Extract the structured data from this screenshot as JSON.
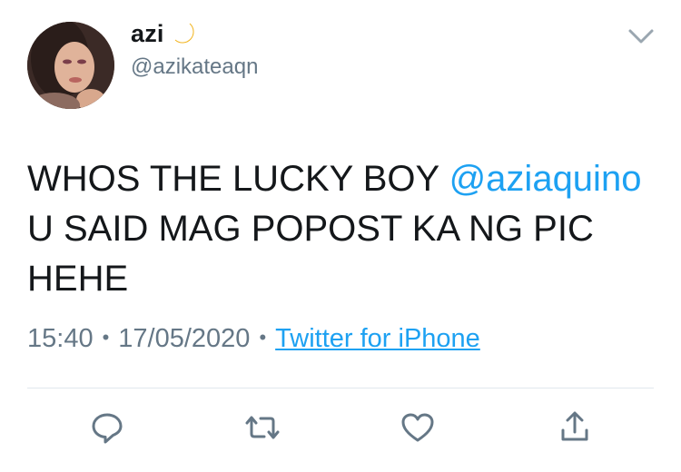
{
  "user": {
    "name": "azi",
    "name_emoji": "crescent-moon",
    "handle": "@azikateaqn"
  },
  "tweet": {
    "text_part1": "WHOS THE LUCKY BOY ",
    "mention": "@aziaquino",
    "text_part2": " U SAID MAG POPOST KA NG PIC HEHE"
  },
  "meta": {
    "time": "15:40",
    "separator": "•",
    "date": "17/05/2020",
    "source": "Twitter for iPhone"
  },
  "actions": {
    "reply_icon": "reply-icon",
    "retweet_icon": "retweet-icon",
    "like_icon": "heart-icon",
    "share_icon": "share-icon"
  },
  "colors": {
    "accent": "#1da1f2",
    "muted": "#657786",
    "text": "#14171a",
    "divider": "#e1e8ed"
  }
}
